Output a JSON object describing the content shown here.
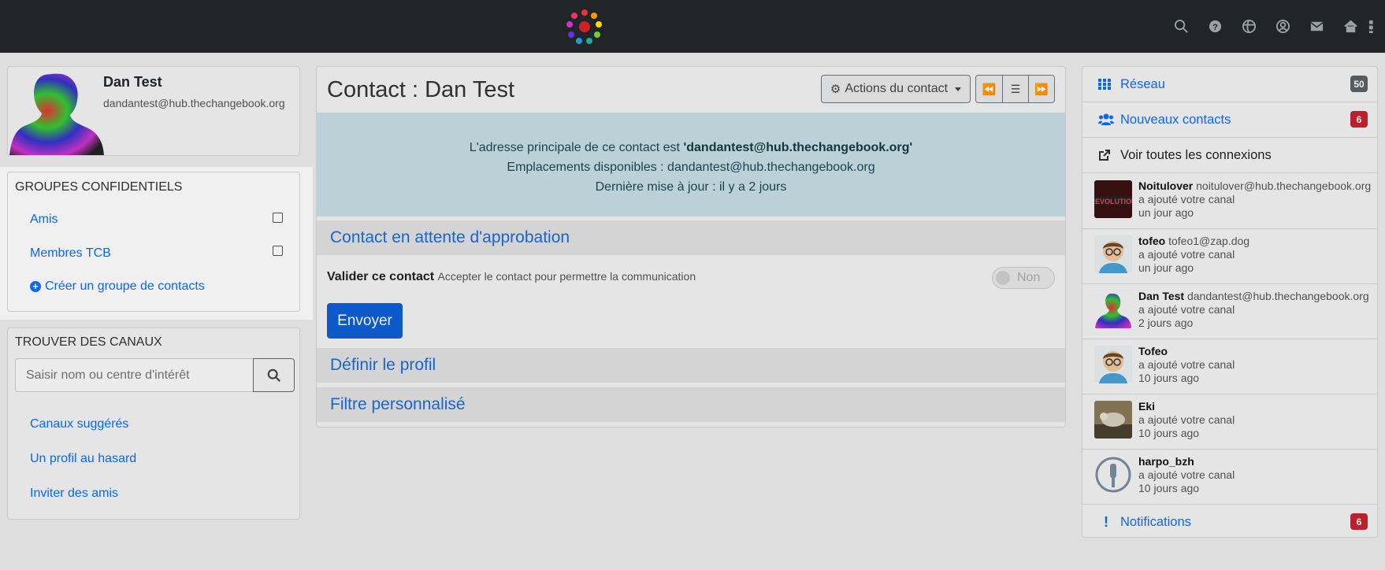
{
  "navbar": {
    "icons": [
      "search-icon",
      "help-icon",
      "globe-icon",
      "user-icon",
      "mail-icon",
      "home-icon",
      "grid-icon"
    ]
  },
  "profile": {
    "name": "Dan Test",
    "address": "dandantest@hub.thechangebook.org"
  },
  "groups": {
    "title": "GROUPES CONFIDENTIELS",
    "items": [
      {
        "label": "Amis",
        "checked": false
      },
      {
        "label": "Membres TCB",
        "checked": false
      }
    ],
    "create_label": "Créer un groupe de contacts"
  },
  "channels": {
    "title": "TROUVER DES CANAUX",
    "search_placeholder": "Saisir nom ou centre d'intérêt",
    "links": [
      "Canaux suggérés",
      "Un profil au hasard",
      "Inviter des amis"
    ]
  },
  "main": {
    "title": "Contact : Dan Test",
    "actions_label": "Actions du contact",
    "info_line1_prefix": "L'adresse principale de ce contact est ",
    "info_line1_address": "'dandantest@hub.thechangebook.org'",
    "info_line2": "Emplacements disponibles : dandantest@hub.thechangebook.org",
    "info_line3": "Dernière mise à jour : il y a 2 jours",
    "pending_section": "Contact en attente d'approbation",
    "validate_label": "Valider ce contact",
    "validate_desc": "Accepter le contact pour permettre la communication",
    "toggle_label": "Non",
    "send_label": "Envoyer",
    "profile_section": "Définir le profil",
    "filter_section": "Filtre personnalisé"
  },
  "right": {
    "network_label": "Réseau",
    "network_count": "50",
    "new_contacts_label": "Nouveaux contacts",
    "new_contacts_count": "6",
    "all_connections_label": "Voir toutes les connexions",
    "connections": [
      {
        "name": "Noitulover",
        "addr": "noitulover@hub.thechangebook.org",
        "action": "a ajouté votre canal",
        "time": "un jour ago"
      },
      {
        "name": "tofeo",
        "addr": "tofeo1@zap.dog",
        "action": "a ajouté votre canal",
        "time": "un jour ago"
      },
      {
        "name": "Dan Test",
        "addr": "dandantest@hub.thechangebook.org",
        "action": "a ajouté votre canal",
        "time": "2 jours ago"
      },
      {
        "name": "Tofeo",
        "addr": "",
        "action": "a ajouté votre canal",
        "time": "10 jours ago"
      },
      {
        "name": "Eki",
        "addr": "",
        "action": "a ajouté votre canal",
        "time": "10 jours ago"
      },
      {
        "name": "harpo_bzh",
        "addr": "",
        "action": "a ajouté votre canal",
        "time": "10 jours ago"
      }
    ],
    "notifications_label": "Notifications",
    "notifications_count": "6"
  },
  "colors": {
    "navbar": "#212529",
    "link": "#0d6efd",
    "info_bg": "#c7dfe5",
    "badge_red": "#c72231",
    "badge_gray": "#5b6168"
  }
}
